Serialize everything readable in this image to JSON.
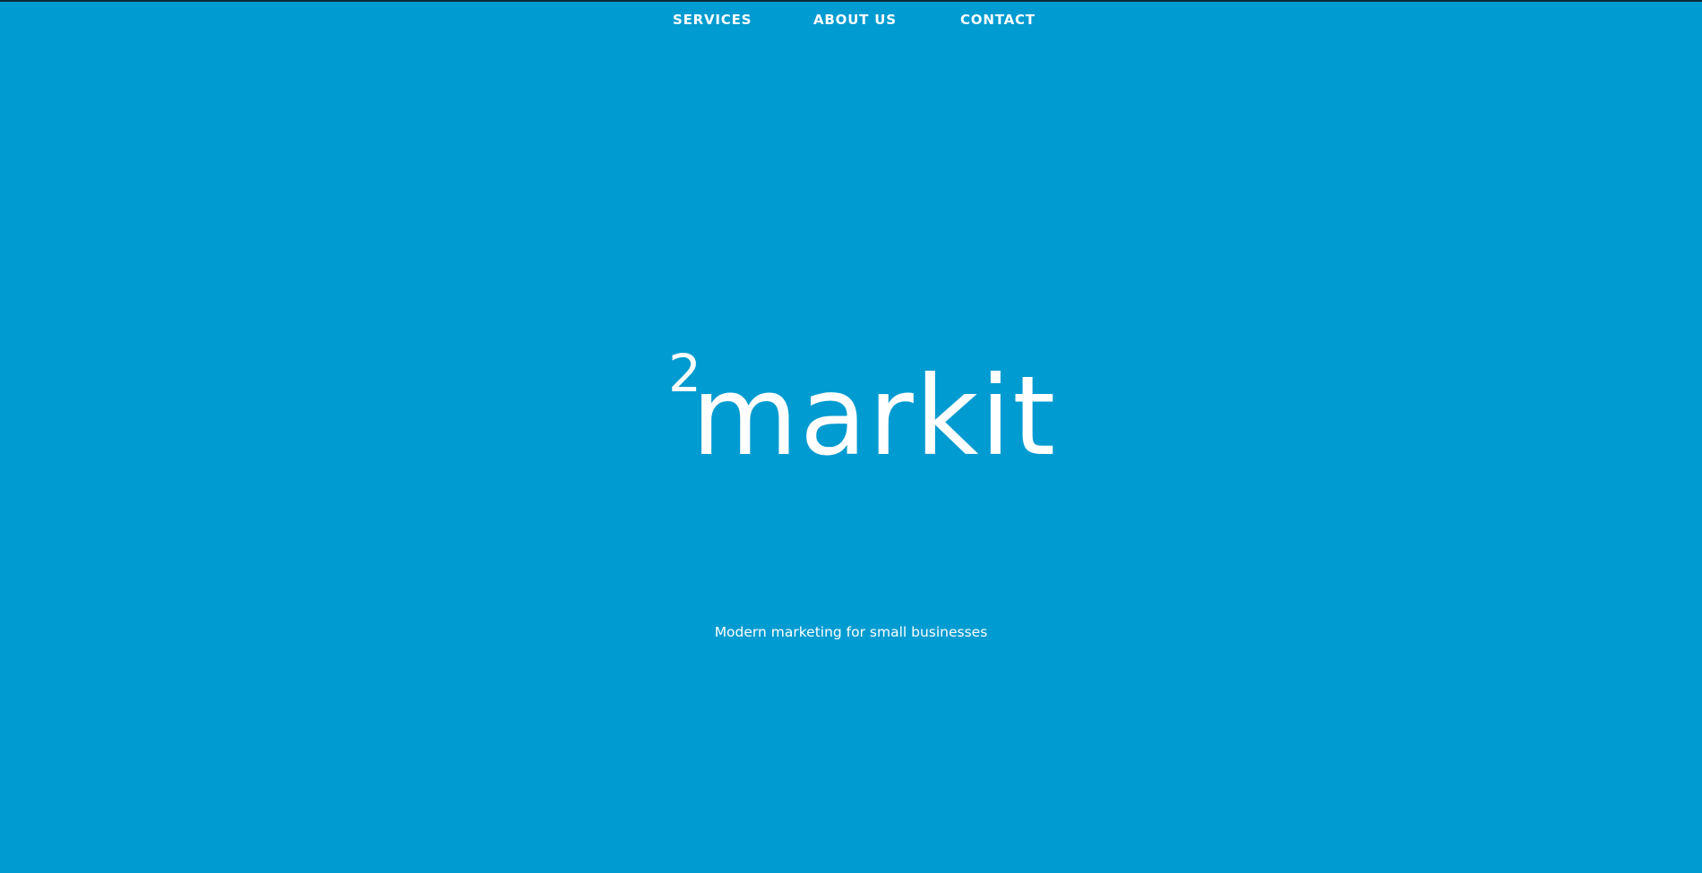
{
  "nav": {
    "items": [
      {
        "label": "SERVICES"
      },
      {
        "label": "ABOUT US"
      },
      {
        "label": "CONTACT"
      }
    ]
  },
  "hero": {
    "logo_superscript": "2",
    "logo_word": "markit",
    "tagline": "Modern marketing for small businesses"
  },
  "colors": {
    "background": "#009bd0",
    "text": "#ffffff",
    "top_border": "#0b2b3a"
  }
}
